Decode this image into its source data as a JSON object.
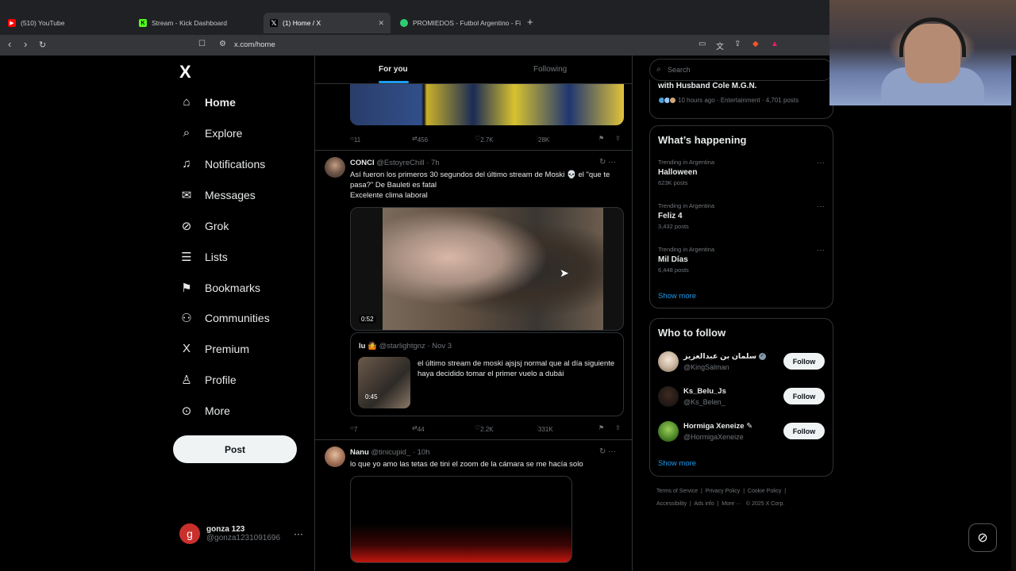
{
  "browser": {
    "tabs": [
      {
        "title": "(510) YouTube",
        "color": "#ff0000",
        "glyph": "▶"
      },
      {
        "title": "Stream - Kick Dashboard",
        "color": "#53fc18",
        "glyph": "K"
      },
      {
        "title": "(1) Home / X",
        "color": "#ffffff",
        "glyph": "𝕏",
        "active": true
      },
      {
        "title": "PROMIEDOS - Futbol Argentino - Fixt...",
        "color": "#2ecc71",
        "glyph": "●"
      }
    ],
    "url": "x.com/home",
    "new_tab": "+",
    "close_tab": "✕"
  },
  "nav": {
    "logo": "X",
    "items": [
      {
        "label": "Home",
        "icon": "home-icon",
        "glyph": "⌂",
        "active": true
      },
      {
        "label": "Explore",
        "icon": "search-icon",
        "glyph": "⌕"
      },
      {
        "label": "Notifications",
        "icon": "bell-icon",
        "glyph": "🔔︎"
      },
      {
        "label": "Messages",
        "icon": "mail-icon",
        "glyph": "✉"
      },
      {
        "label": "Grok",
        "icon": "grok-icon",
        "glyph": "⊘"
      },
      {
        "label": "Lists",
        "icon": "list-icon",
        "glyph": "☰"
      },
      {
        "label": "Bookmarks",
        "icon": "bookmark-icon",
        "glyph": "🔖︎"
      },
      {
        "label": "Communities",
        "icon": "people-icon",
        "glyph": "⚇"
      },
      {
        "label": "Premium",
        "icon": "x-icon",
        "glyph": "X"
      },
      {
        "label": "Profile",
        "icon": "person-icon",
        "glyph": "♙"
      },
      {
        "label": "More",
        "icon": "more-circle-icon",
        "glyph": "⊙"
      }
    ],
    "post_label": "Post",
    "account": {
      "initial": "g",
      "name": "gonza 123",
      "handle": "@gonza1231091696",
      "more": "···"
    }
  },
  "timeline": {
    "tabs": {
      "for_you": "For you",
      "following": "Following"
    },
    "tweet0_actions": {
      "replies": "11",
      "reposts": "456",
      "likes": "2.7K",
      "views": "28K"
    },
    "tweet1": {
      "name": "CONCI",
      "handle": "@EstoyreChill",
      "time": "· 7h",
      "line1": "Así fueron los primeros 30 segundos del último stream de Moski 💀 el \"que te pasa?\" De Bauleti es fatal",
      "line2": "Excelente clima laboral",
      "video_duration": "0:52",
      "quote": {
        "name": "lu 🤷",
        "handle": "@starlightgnz",
        "time": "· Nov 3",
        "text": "el último stream de moski ajsjsj normal que al día siguiente haya decidido tomar el primer vuelo a dubái",
        "video_duration": "0:45"
      },
      "actions": {
        "replies": "7",
        "reposts": "44",
        "likes": "2.2K",
        "views": "331K"
      }
    },
    "tweet2": {
      "name": "Nanu",
      "handle": "@tinicupid_",
      "time": "· 10h",
      "text": "lo que yo amo las tetas de tini el zoom de la cámara se me hacía solo"
    }
  },
  "right": {
    "search_placeholder": "Search",
    "top_card": {
      "headline": "with Husband Cole M.G.N.",
      "meta": "10 hours ago · Entertainment · 4,701 posts"
    },
    "happening": {
      "title": "What’s happening",
      "trends": [
        {
          "context": "Trending in Argentina",
          "name": "Halloween",
          "posts": "623K posts"
        },
        {
          "context": "Trending in Argentina",
          "name": "Feliz 4",
          "posts": "3,432 posts"
        },
        {
          "context": "Trending in Argentina",
          "name": "Mil Días",
          "posts": "6,448 posts"
        }
      ],
      "show_more": "Show more"
    },
    "who_to_follow": {
      "title": "Who to follow",
      "users": [
        {
          "name": "سلمان بن عبدالعزيز",
          "handle": "@KingSalman",
          "verified": true
        },
        {
          "name": "Ks_Belu_Js",
          "handle": "@Ks_Belen_",
          "verified": false
        },
        {
          "name": "Hormiga Xeneize ✎",
          "handle": "@HormigaXeneize",
          "verified": false
        }
      ],
      "follow_label": "Follow",
      "show_more": "Show more"
    },
    "footer": {
      "line1": [
        "Terms of Service",
        "Privacy Policy",
        "Cookie Policy"
      ],
      "line2": [
        "Accessibility",
        "Ads info",
        "More ···",
        "© 2025 X Corp."
      ]
    }
  }
}
